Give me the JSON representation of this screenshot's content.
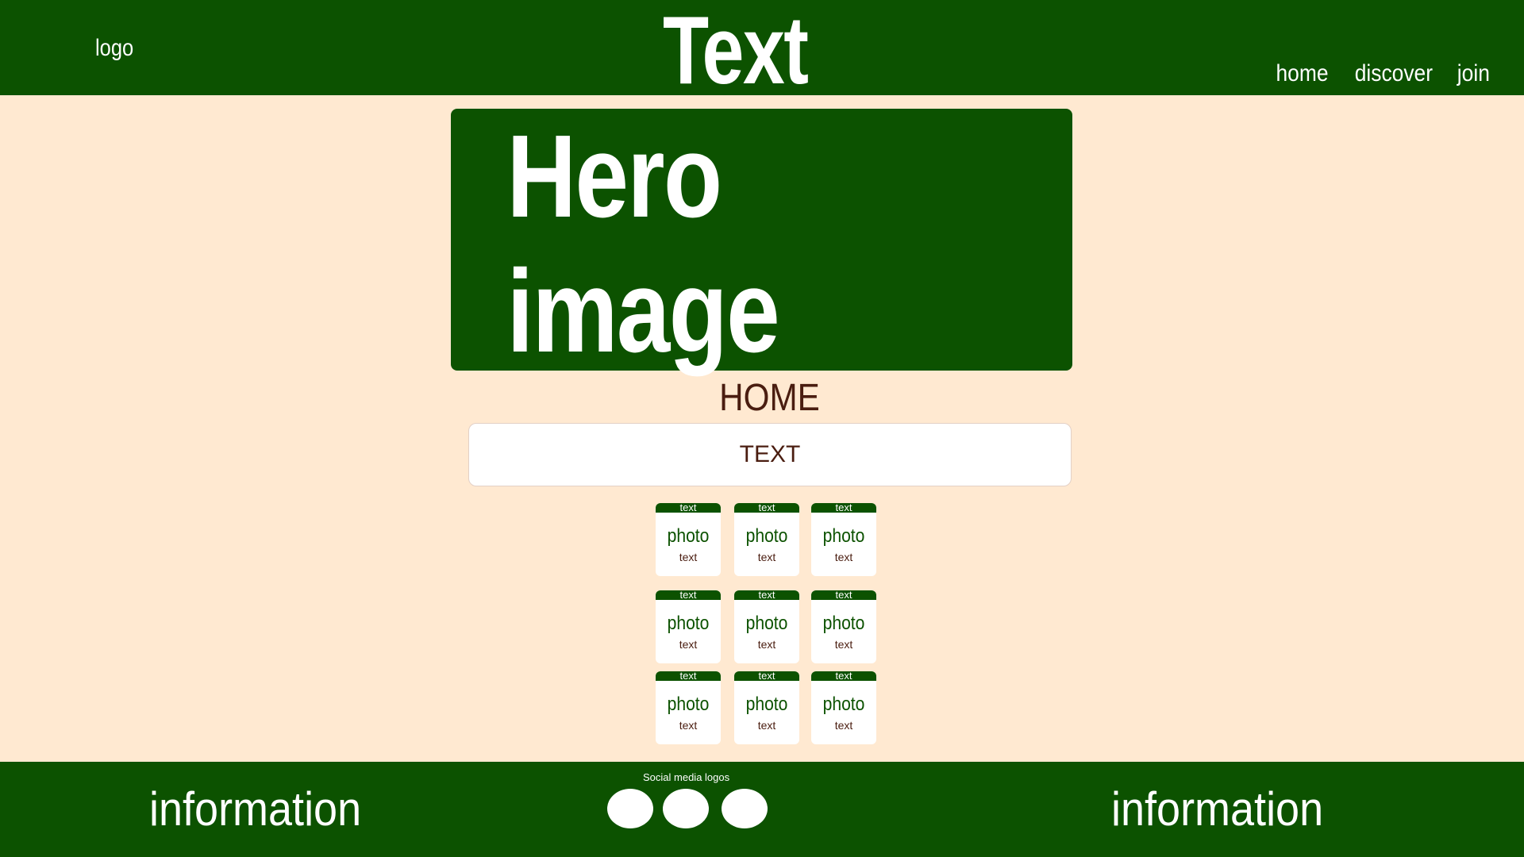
{
  "header": {
    "logo": "logo",
    "title": "Text",
    "nav": [
      "home",
      "discover",
      "join"
    ]
  },
  "hero": {
    "label": "Hero image"
  },
  "main": {
    "heading": "HOME",
    "text_box": "TEXT",
    "cards": [
      {
        "top": "text",
        "photo": "photo",
        "text": "text"
      },
      {
        "top": "text",
        "photo": "photo",
        "text": "text"
      },
      {
        "top": "text",
        "photo": "photo",
        "text": "text"
      },
      {
        "top": "text",
        "photo": "photo",
        "text": "text"
      },
      {
        "top": "text",
        "photo": "photo",
        "text": "text"
      },
      {
        "top": "text",
        "photo": "photo",
        "text": "text"
      },
      {
        "top": "text",
        "photo": "photo",
        "text": "text"
      },
      {
        "top": "text",
        "photo": "photo",
        "text": "text"
      },
      {
        "top": "text",
        "photo": "photo",
        "text": "text"
      }
    ]
  },
  "footer": {
    "info_left": "information",
    "info_right": "information",
    "social_label": "Social media logos",
    "social_icons": [
      "social-icon-1",
      "social-icon-2",
      "social-icon-3"
    ]
  },
  "colors": {
    "primary_green": "#0c5200",
    "background": "#ffe9d1",
    "text_brown": "#4a1d10"
  }
}
